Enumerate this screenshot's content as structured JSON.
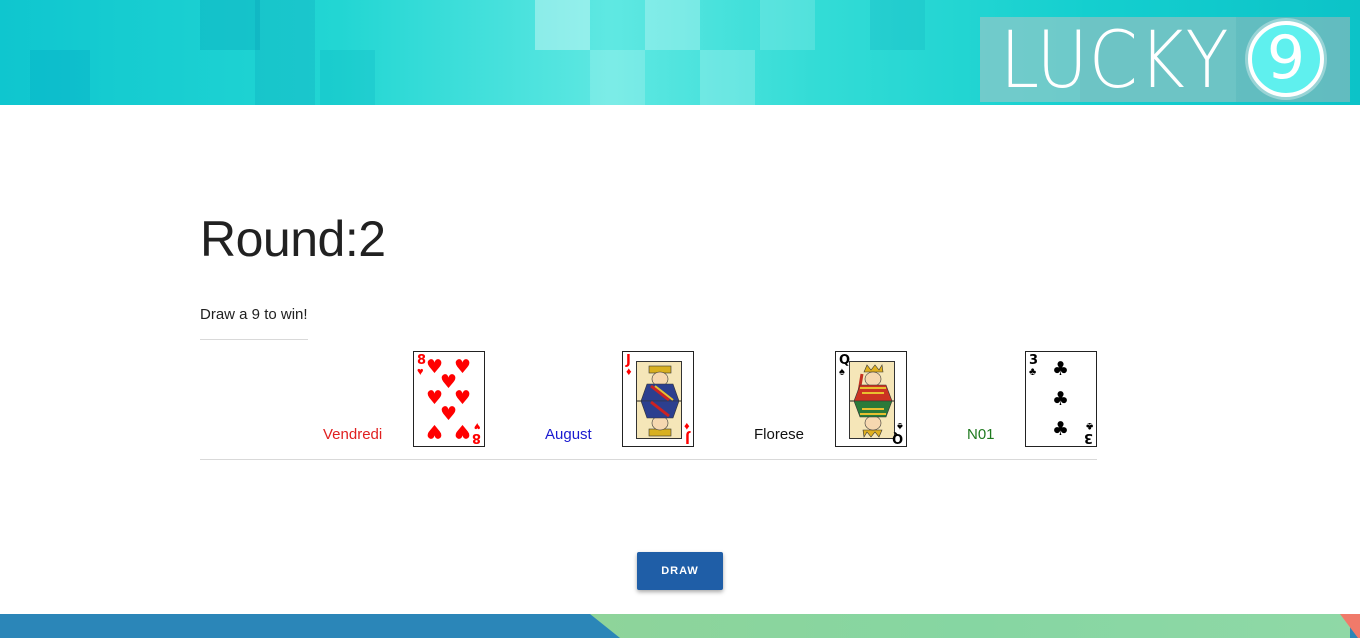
{
  "header": {
    "logo_text": "LUCKY",
    "logo_number": "9"
  },
  "game": {
    "round_label": "Round:2",
    "instructions": "Draw a 9 to win!",
    "players": [
      {
        "name": "Vendredi",
        "color": "#e02020",
        "card": {
          "rank": "8",
          "suit": "hearts",
          "suit_symbol": "♥",
          "suit_color": "#ff0000"
        }
      },
      {
        "name": "August",
        "color": "#1a1ad0",
        "card": {
          "rank": "J",
          "suit": "diamonds",
          "suit_symbol": "♦",
          "suit_color": "#ff0000"
        }
      },
      {
        "name": "Florese",
        "color": "#111111",
        "card": {
          "rank": "Q",
          "suit": "spades",
          "suit_symbol": "♠",
          "suit_color": "#000000"
        }
      },
      {
        "name": "N01",
        "color": "#1f7a1f",
        "card": {
          "rank": "3",
          "suit": "clubs",
          "suit_symbol": "♣",
          "suit_color": "#000000"
        }
      }
    ]
  },
  "actions": {
    "draw_label": "DRAW"
  },
  "colors": {
    "banner_teal": "#14cfcf",
    "button_blue": "#1f5ea7",
    "footer_blue": "#2b86b8",
    "footer_green": "#8ed49a",
    "footer_red": "#f07a6a"
  }
}
